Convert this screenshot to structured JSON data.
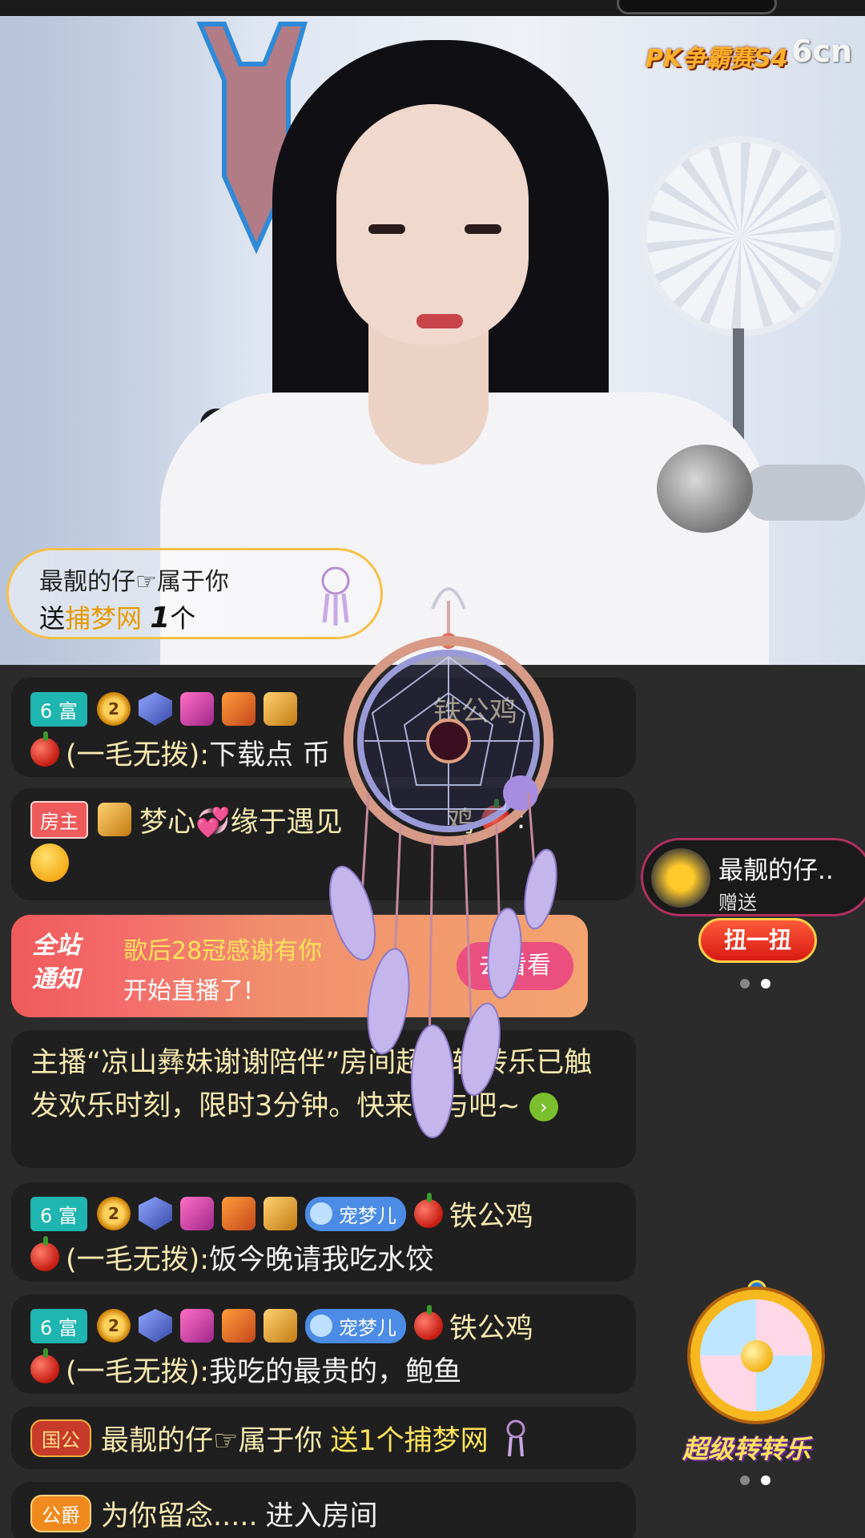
{
  "video": {
    "brand": "PK争霸赛S4",
    "logo": "6cn"
  },
  "gift_banner": {
    "sender": "最靓的仔☞属于你",
    "send_word": "送",
    "gift_name": "捕梦网",
    "quantity": "1",
    "unit": "个"
  },
  "chat": {
    "messages": [
      {
        "badge": "6 富",
        "user": "铁公鸡",
        "prefix": "(一毛无拨): ",
        "text": "下载点 币"
      },
      {
        "badge": "房主",
        "user": "梦心💞缘于遇见",
        "user_tail": "鸡",
        "colon": ":"
      },
      {
        "notice_tag_1": "全站",
        "notice_tag_2": "通知",
        "notice_line1": "歌后28冠感谢有你",
        "notice_line2": "开始直播了!",
        "notice_button": "去看看"
      },
      {
        "text": "主播“凉山彝妹谢谢陪伴”房间超级转转乐已触发欢乐时刻，限时3分钟。快来参与吧~"
      },
      {
        "badge": "6 富",
        "pet": "宠梦儿",
        "user": "铁公鸡",
        "prefix": "(一毛无拨): ",
        "text": "饭今晚请我吃水饺"
      },
      {
        "badge": "6 富",
        "pet": "宠梦儿",
        "user": "铁公鸡",
        "prefix": "(一毛无拨): ",
        "text": "我吃的最贵的，鲍鱼"
      },
      {
        "badge": "国公",
        "user": "最靓的仔☞属于你",
        "action": "送1个捕梦网"
      },
      {
        "badge": "公爵",
        "user": "为你留念.....",
        "action": "进入房间"
      }
    ]
  },
  "side": {
    "gift_pop_name": "最靓的仔..",
    "gift_pop_sub": "赠送",
    "twist_button": "扭一扭",
    "wheel_label": "超级转转乐"
  },
  "colors": {
    "accent_gold": "#f6c048",
    "rich_badge": "#1fb5b0",
    "notice_red": "#f05a5a"
  }
}
